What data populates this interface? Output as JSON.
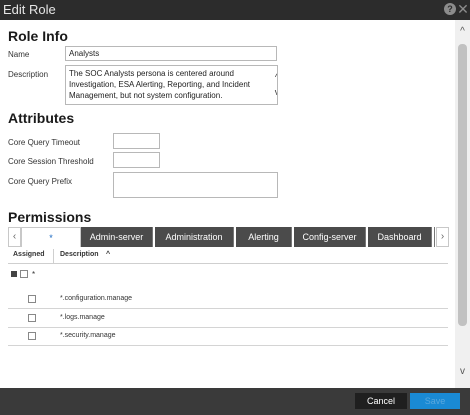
{
  "dialog": {
    "title": "Edit Role",
    "help_symbol": "?",
    "close_symbol": "✕"
  },
  "role_info": {
    "heading": "Role Info",
    "name_label": "Name",
    "name_value": "Analysts",
    "description_label": "Description",
    "description_value": "The SOC Analysts persona is centered around Investigation, ESA Alerting, Reporting, and Incident Management, but not system configuration."
  },
  "attributes": {
    "heading": "Attributes",
    "core_query_timeout_label": "Core Query Timeout",
    "core_query_timeout_value": "",
    "core_session_threshold_label": "Core Session Threshold",
    "core_session_threshold_value": "",
    "core_query_prefix_label": "Core Query Prefix",
    "core_query_prefix_value": ""
  },
  "permissions": {
    "heading": "Permissions",
    "tab_prev": "‹",
    "tab_next": "›",
    "tabs": [
      "*",
      "Admin-server",
      "Administration",
      "Alerting",
      "Config-server",
      "Dashboard"
    ],
    "active_tab": "*",
    "table": {
      "col_assigned": "Assigned",
      "col_description": "Description",
      "sort_symbol": "^",
      "group_label": "*",
      "rows": [
        {
          "description": "*.configuration.manage",
          "assigned": false
        },
        {
          "description": "*.logs.manage",
          "assigned": false
        },
        {
          "description": "*.security.manage",
          "assigned": false
        }
      ]
    }
  },
  "scroll": {
    "up": "^",
    "down": "v"
  },
  "footer": {
    "cancel_label": "Cancel",
    "save_label": "Save"
  },
  "colors": {
    "titlebar": "#2c2c2c",
    "tab_bg": "#4b4b4b",
    "active_tab_text": "#1565c0",
    "save_button": "#1a8ad4"
  }
}
